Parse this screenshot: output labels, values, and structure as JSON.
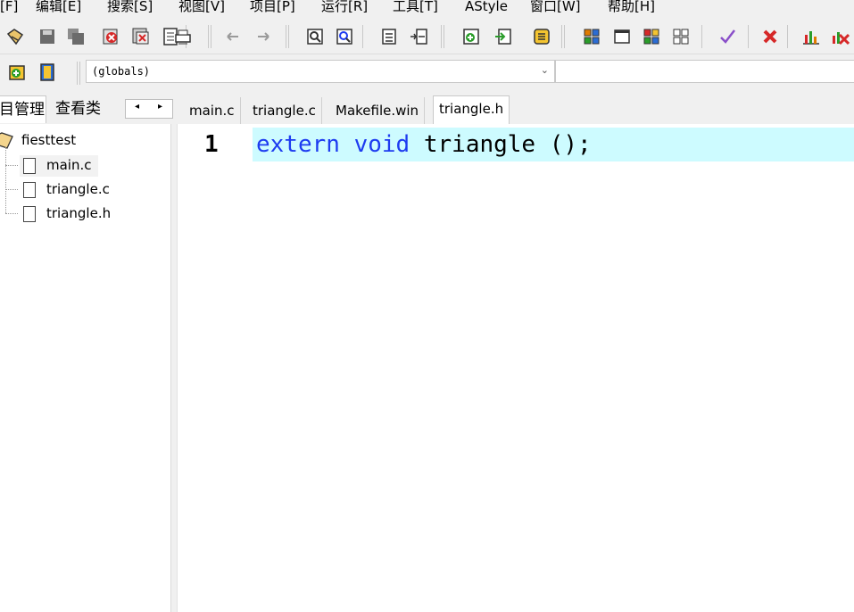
{
  "menu": {
    "items": [
      "[F]",
      "编辑[E]",
      "搜索[S]",
      "视图[V]",
      "项目[P]",
      "运行[R]",
      "工具[T]",
      "AStyle",
      "窗口[W]",
      "帮助[H]"
    ]
  },
  "toolbar": {
    "combo_value": "(globals)"
  },
  "left_panel": {
    "tabs": [
      "目管理",
      "查看类"
    ],
    "scroll_left": "◂",
    "scroll_right": "▸",
    "project": "fiesttest",
    "files": [
      "main.c",
      "triangle.c",
      "triangle.h"
    ]
  },
  "editor": {
    "tabs": [
      "main.c",
      "triangle.c",
      "Makefile.win",
      "triangle.h"
    ],
    "active_tab": "triangle.h",
    "line_number": "1",
    "code": {
      "kw1": "extern",
      "kw2": "void",
      "rest": "triangle ();"
    }
  },
  "colors": {
    "keyword": "#1e3cf0",
    "current_line": "#cdfbff"
  }
}
